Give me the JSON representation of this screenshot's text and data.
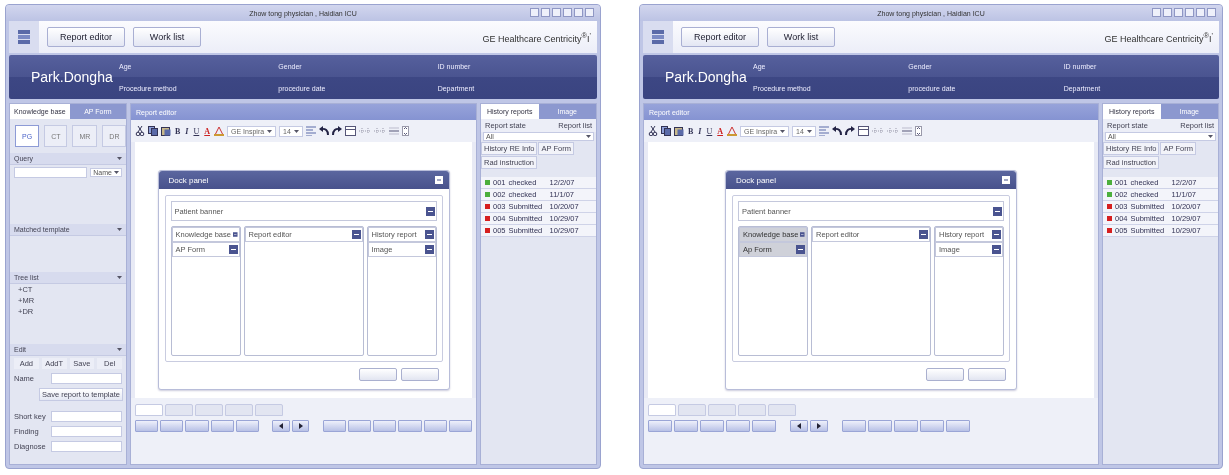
{
  "windows": [
    {
      "title": "Zhow tong physician , Haidian ICU",
      "nav_buttons": [
        "Report editor",
        "Work list"
      ],
      "brand": "GE Healthcare Centricity$^{®}$I$^{'}$",
      "patient": {
        "name": "Park.Dongha",
        "fields": [
          "Age",
          "Gender",
          "ID number",
          "Procedure method",
          "procedure date",
          "Department"
        ]
      },
      "sidebar": {
        "tabs": [
          {
            "label": "Knowledge base",
            "selected": true
          },
          {
            "label": "AP Form",
            "selected": false
          }
        ],
        "modalities": [
          {
            "label": "PG",
            "selected": true
          },
          {
            "label": "CT",
            "selected": false
          },
          {
            "label": "MR",
            "selected": false
          },
          {
            "label": "DR",
            "selected": false
          }
        ],
        "query": {
          "title": "Query",
          "dropdown": "Name"
        },
        "matched": "Matched template",
        "tree": {
          "title": "Tree list",
          "items": [
            "+CT",
            "+MR",
            "+DR"
          ]
        },
        "edit": {
          "title": "Edit",
          "buttons": [
            "Add",
            "AddT",
            "Save",
            "Del"
          ],
          "name_label": "Name",
          "save_button": "Save report to template",
          "fields": [
            "Short key",
            "Finding",
            "Diagnose"
          ]
        }
      },
      "editor": {
        "title": "Report editor",
        "format_buttons": [
          "B",
          "I",
          "U",
          "A"
        ],
        "font": "GE Inspira",
        "size": "14",
        "dock": {
          "title": "Dock panel",
          "banner": "Patient banner",
          "left": [
            {
              "label": "Knowledge base",
              "selected": false
            },
            {
              "label": "AP Form",
              "selected": false
            }
          ],
          "center": "Report editor",
          "right": [
            "History report",
            "Image"
          ],
          "buttons": [
            {
              "kind": "button"
            },
            {
              "kind": "button"
            }
          ]
        },
        "tabs": [
          {
            "selected": true
          },
          {
            "selected": false
          },
          {
            "selected": false
          },
          {
            "selected": false
          },
          {
            "selected": false
          }
        ],
        "buttons": [
          {
            "kind": "button"
          },
          {
            "kind": "button"
          },
          {
            "kind": "button"
          },
          {
            "kind": "button"
          },
          {
            "kind": "button"
          },
          {
            "kind": "prev"
          },
          {
            "kind": "next"
          },
          {
            "kind": "button"
          },
          {
            "kind": "button"
          },
          {
            "kind": "button"
          },
          {
            "kind": "button"
          },
          {
            "kind": "button"
          },
          {
            "kind": "button"
          }
        ]
      },
      "history": {
        "tabs": [
          {
            "label": "History reports",
            "selected": true
          },
          {
            "label": "Image",
            "selected": false
          }
        ],
        "buttons": [
          "Report state",
          "Report list"
        ],
        "filter": "All",
        "subtabs": [
          "History RE Info",
          "AP Form",
          "Rad instruction"
        ],
        "rows": [
          {
            "id": "001",
            "status": "checked",
            "date": "12/2/07",
            "color": "#4caf3c"
          },
          {
            "id": "002",
            "status": "checked",
            "date": "11/1/07",
            "color": "#4caf3c"
          },
          {
            "id": "003",
            "status": "Submitted",
            "date": "10/20/07",
            "color": "#d61f1f"
          },
          {
            "id": "004",
            "status": "Submitted",
            "date": "10/29/07",
            "color": "#d61f1f"
          },
          {
            "id": "005",
            "status": "Submitted",
            "date": "10/29/07",
            "color": "#d61f1f"
          }
        ]
      }
    },
    {
      "title": "Zhow tong physician , Haidian ICU",
      "nav_buttons": [
        "Report editor",
        "Work list"
      ],
      "brand": "GE Healthcare Centricity$^{®}$I$^{'}$",
      "patient": {
        "name": "Park.Dongha",
        "fields": [
          "Age",
          "Gender",
          "ID number",
          "Procedure method",
          "procedure date",
          "Department"
        ]
      },
      "editor": {
        "title": "Report editor",
        "format_buttons": [
          "B",
          "I",
          "U",
          "A"
        ],
        "font": "GE Inspira",
        "size": "14",
        "dock": {
          "title": "Dock panel",
          "banner": "Patient banner",
          "left": [
            {
              "label": "Knowledge base",
              "selected": true
            },
            {
              "label": "Ap Form",
              "selected": true
            }
          ],
          "center": "Report editor",
          "right": [
            "History report",
            "Image"
          ],
          "buttons": [
            {
              "kind": "button"
            },
            {
              "kind": "button"
            }
          ]
        },
        "tabs": [
          {
            "selected": true
          },
          {
            "selected": false
          },
          {
            "selected": false
          },
          {
            "selected": false
          },
          {
            "selected": false
          }
        ],
        "buttons": [
          {
            "kind": "button"
          },
          {
            "kind": "button"
          },
          {
            "kind": "button"
          },
          {
            "kind": "button"
          },
          {
            "kind": "button"
          },
          {
            "kind": "prev"
          },
          {
            "kind": "next"
          },
          {
            "kind": "button"
          },
          {
            "kind": "button"
          },
          {
            "kind": "button"
          },
          {
            "kind": "button"
          },
          {
            "kind": "button"
          }
        ]
      },
      "history": {
        "tabs": [
          {
            "label": "History reports",
            "selected": true
          },
          {
            "label": "Image",
            "selected": false
          }
        ],
        "buttons": [
          "Report state",
          "Report list"
        ],
        "filter": "All",
        "subtabs": [
          "History RE Info",
          "AP Form",
          "Rad instruction"
        ],
        "rows": [
          {
            "id": "001",
            "status": "checked",
            "date": "12/2/07",
            "color": "#4caf3c"
          },
          {
            "id": "002",
            "status": "checked",
            "date": "11/1/07",
            "color": "#4caf3c"
          },
          {
            "id": "003",
            "status": "Submitted",
            "date": "10/20/07",
            "color": "#d61f1f"
          },
          {
            "id": "004",
            "status": "Submitted",
            "date": "10/29/07",
            "color": "#d61f1f"
          },
          {
            "id": "005",
            "status": "Submitted",
            "date": "10/29/07",
            "color": "#d61f1f"
          }
        ]
      }
    }
  ]
}
